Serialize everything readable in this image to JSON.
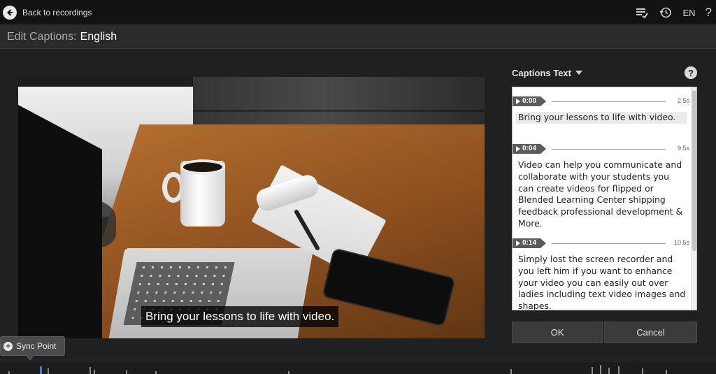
{
  "header": {
    "back_label": "Back to recordings",
    "language_code": "EN",
    "help_glyph": "?",
    "icons": [
      "back-arrow-icon",
      "captions-edit-icon",
      "history-icon",
      "help-icon"
    ]
  },
  "title": {
    "prefix": "Edit Captions:",
    "value": "English"
  },
  "video": {
    "caption_overlay": "Bring your lessons to life with video."
  },
  "panel": {
    "header_label": "Captions Text",
    "help_glyph": "?",
    "captions": [
      {
        "time": "0:00",
        "duration": "2.5s",
        "text": "Bring your lessons to life with video."
      },
      {
        "time": "0:04",
        "duration": "9.5s",
        "text": "Video can help you communicate and collaborate with your students you can create videos for flipped or Blended Learning Center shipping feedback professional development & More."
      },
      {
        "time": "0:14",
        "duration": "10.5s",
        "text": "Simply lost the screen recorder and you left him if you want to enhance your video you can easily out over ladies including text video images and shapes."
      }
    ],
    "ok_label": "OK",
    "cancel_label": "Cancel"
  },
  "timeline": {
    "sync_label": "Sync Point",
    "sync_glyph": "+"
  },
  "colors": {
    "background": "#1f2021",
    "topbar": "#111213",
    "titlebar": "#2a2b2c",
    "timestamp_tag": "#5b5b5b",
    "playhead": "#4a78c6"
  }
}
